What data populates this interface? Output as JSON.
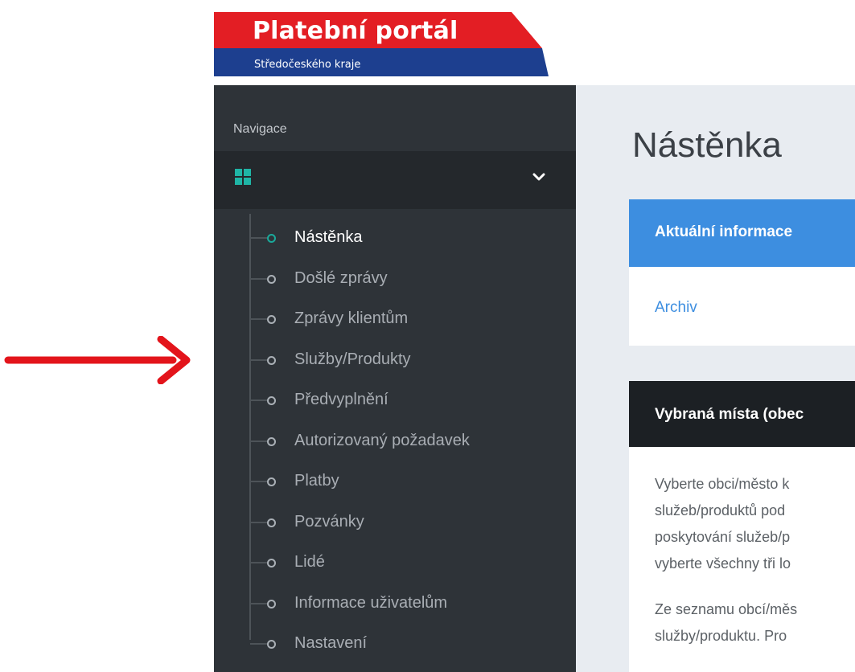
{
  "header": {
    "logo_title": "Platební portál",
    "logo_subtitle": "Středočeského kraje"
  },
  "sidebar": {
    "heading": "Navigace",
    "group_icon": "grid-icon",
    "items": [
      {
        "label": "Nástěnka",
        "active": true
      },
      {
        "label": "Došlé zprávy"
      },
      {
        "label": "Zprávy klientům"
      },
      {
        "label": "Služby/Produkty"
      },
      {
        "label": "Předvyplnění"
      },
      {
        "label": "Autorizovaný požadavek"
      },
      {
        "label": "Platby"
      },
      {
        "label": "Pozvánky"
      },
      {
        "label": "Lidé"
      },
      {
        "label": "Informace uživatelům"
      },
      {
        "label": "Nastavení"
      }
    ]
  },
  "main": {
    "title": "Nástěnka",
    "info_card": {
      "title": "Aktuální informace",
      "link": "Archiv"
    },
    "places_card": {
      "title": "Vybraná místa (obec",
      "lines": [
        "Vyberte obci/město k",
        "služeb/produktů pod",
        "poskytování služeb/p",
        "vyberte všechny tři lo"
      ],
      "line2": "Ze seznamu obcí/měs",
      "line3": "služby/produktu. Pro"
    }
  },
  "colors": {
    "brand_red": "#e31e24",
    "brand_blue": "#1d3f8f",
    "sidebar_bg": "#2e3338",
    "accent_teal": "#1aa99a",
    "info_blue": "#3d8ee0",
    "annotation_arrow": "#e3141b"
  }
}
